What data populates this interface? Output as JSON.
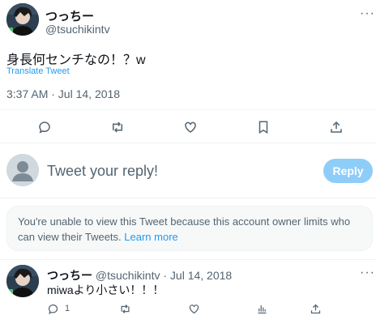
{
  "tweet": {
    "display_name": "つっちー",
    "handle": "@tsuchikintv",
    "text": "身長何センチなの！？w",
    "translate_label": "Translate Tweet",
    "timestamp": "3:37 AM · Jul 14, 2018",
    "more_label": "···"
  },
  "reply_composer": {
    "placeholder": "Tweet your reply!",
    "button_label": "Reply"
  },
  "notice": {
    "text": "You're unable to view this Tweet because this account owner limits who can view their Tweets.",
    "link_label": "Learn more"
  },
  "reply": {
    "display_name": "つっちー",
    "handle": "@tsuchikintv",
    "separator": "·",
    "date": "Jul 14, 2018",
    "text": "miwaより小さい！！！",
    "reply_count": "1",
    "more_label": "···"
  },
  "colors": {
    "accent": "#1d9bf0",
    "reply_button_disabled": "#8ecdf8",
    "secondary_text": "#536471"
  }
}
